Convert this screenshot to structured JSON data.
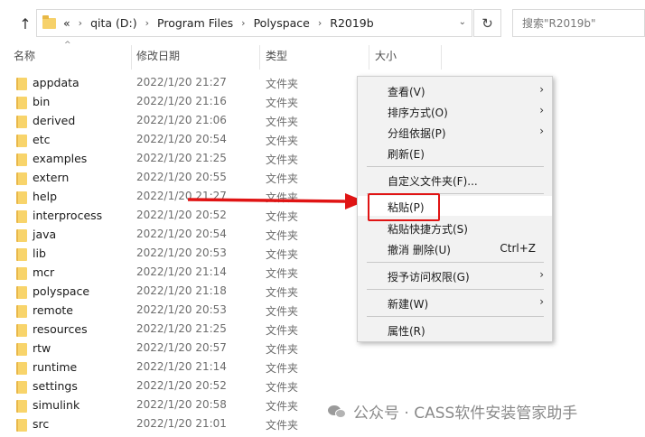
{
  "address_bar": {
    "overflow": "«",
    "crumbs": [
      "qita (D:)",
      "Program Files",
      "Polyspace",
      "R2019b"
    ],
    "search_placeholder": "搜索\"R2019b\""
  },
  "columns": {
    "name": "名称",
    "date": "修改日期",
    "type": "类型",
    "size": "大小"
  },
  "files": [
    {
      "name": "appdata",
      "date": "2022/1/20 21:27",
      "type": "文件夹"
    },
    {
      "name": "bin",
      "date": "2022/1/20 21:16",
      "type": "文件夹"
    },
    {
      "name": "derived",
      "date": "2022/1/20 21:06",
      "type": "文件夹"
    },
    {
      "name": "etc",
      "date": "2022/1/20 20:54",
      "type": "文件夹"
    },
    {
      "name": "examples",
      "date": "2022/1/20 21:25",
      "type": "文件夹"
    },
    {
      "name": "extern",
      "date": "2022/1/20 20:55",
      "type": "文件夹"
    },
    {
      "name": "help",
      "date": "2022/1/20 21:27",
      "type": "文件夹"
    },
    {
      "name": "interprocess",
      "date": "2022/1/20 20:52",
      "type": "文件夹"
    },
    {
      "name": "java",
      "date": "2022/1/20 20:54",
      "type": "文件夹"
    },
    {
      "name": "lib",
      "date": "2022/1/20 20:53",
      "type": "文件夹"
    },
    {
      "name": "mcr",
      "date": "2022/1/20 21:14",
      "type": "文件夹"
    },
    {
      "name": "polyspace",
      "date": "2022/1/20 21:18",
      "type": "文件夹"
    },
    {
      "name": "remote",
      "date": "2022/1/20 20:53",
      "type": "文件夹"
    },
    {
      "name": "resources",
      "date": "2022/1/20 21:25",
      "type": "文件夹"
    },
    {
      "name": "rtw",
      "date": "2022/1/20 20:57",
      "type": "文件夹"
    },
    {
      "name": "runtime",
      "date": "2022/1/20 21:14",
      "type": "文件夹"
    },
    {
      "name": "settings",
      "date": "2022/1/20 20:52",
      "type": "文件夹"
    },
    {
      "name": "simulink",
      "date": "2022/1/20 20:58",
      "type": "文件夹"
    },
    {
      "name": "src",
      "date": "2022/1/20 21:01",
      "type": "文件夹"
    }
  ],
  "context_menu": {
    "view": "查看(V)",
    "sort": "排序方式(O)",
    "group": "分组依据(P)",
    "refresh": "刷新(E)",
    "customize": "自定义文件夹(F)...",
    "paste": "粘贴(P)",
    "paste_shortcut": "粘贴快捷方式(S)",
    "undo_delete": "撤消 删除(U)",
    "undo_shortcut": "Ctrl+Z",
    "grant_access": "授予访问权限(G)",
    "new": "新建(W)",
    "properties": "属性(R)"
  },
  "watermark": "公众号 · CASS软件安装管家助手",
  "colors": {
    "highlight_red": "#e01414",
    "folder_yellow": "#f8d46b",
    "menu_bg": "#f2f2f2"
  }
}
